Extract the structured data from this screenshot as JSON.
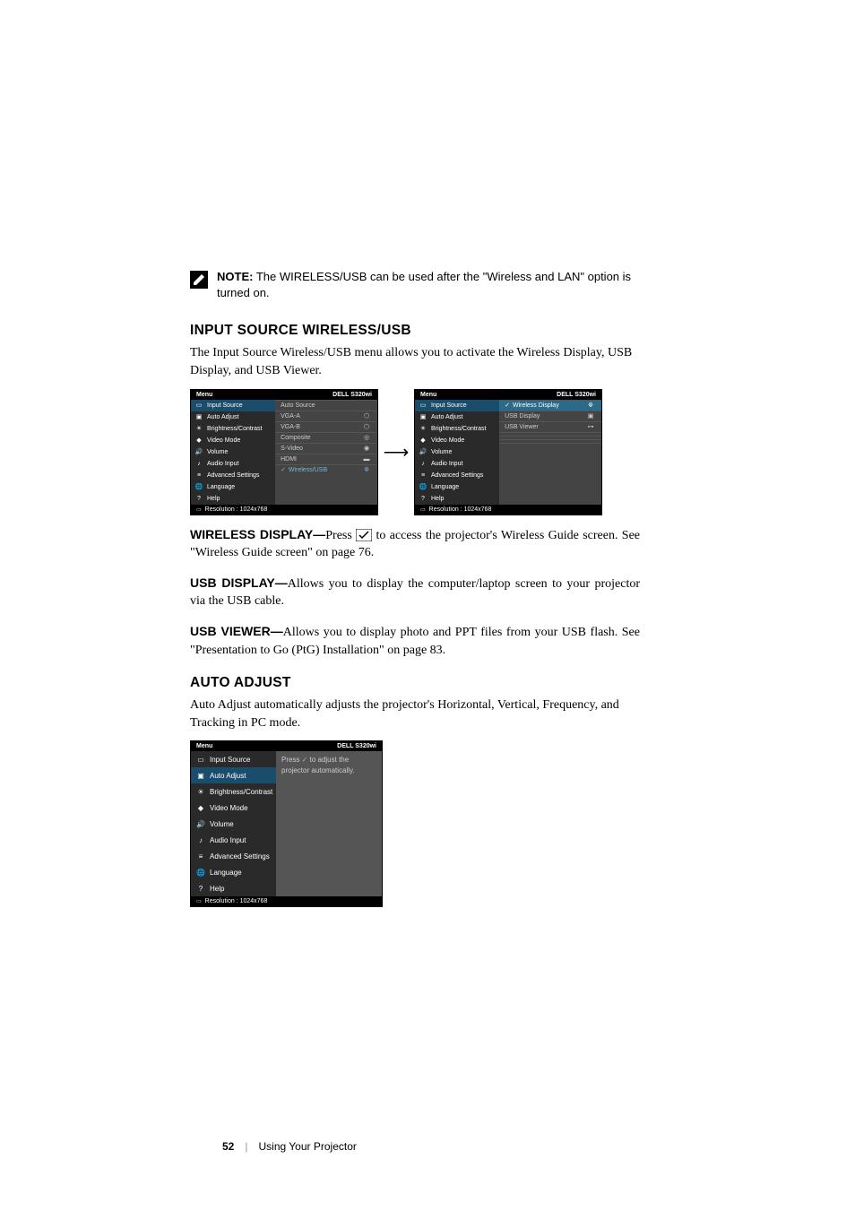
{
  "note": {
    "label": "NOTE:",
    "text": " The WIRELESS/USB can be used after the \"Wireless and LAN\" option is turned on."
  },
  "section1": {
    "heading": "INPUT SOURCE WIRELESS/USB",
    "intro": "The Input Source Wireless/USB menu allows you to activate the Wireless Display, USB Display, and USB Viewer."
  },
  "menu_left": {
    "title": "Menu",
    "model": "DELL S320wi",
    "items": [
      "Input Source",
      "Auto Adjust",
      "Brightness/Contrast",
      "Video Mode",
      "Volume",
      "Audio Input",
      "Advanced Settings",
      "Language",
      "Help"
    ],
    "options": [
      "Auto Source",
      "VGA-A",
      "VGA-B",
      "Composite",
      "S-Video",
      "HDMI",
      "Wireless/USB"
    ],
    "footer": "Resolution : 1024x768"
  },
  "menu_right": {
    "title": "Menu",
    "model": "DELL S320wi",
    "items": [
      "Input Source",
      "Auto Adjust",
      "Brightness/Contrast",
      "Video Mode",
      "Volume",
      "Audio Input",
      "Advanced Settings",
      "Language",
      "Help"
    ],
    "options": [
      "Wireless Display",
      "USB Display",
      "USB Viewer"
    ],
    "footer": "Resolution : 1024x768"
  },
  "defs": {
    "wireless": {
      "label": "WIRELESS DISPLAY—",
      "text1": "Press ",
      "text2": " to access the projector's Wireless Guide screen. See \"Wireless Guide screen\" on page 76."
    },
    "usb_display": {
      "label": "USB DISPLAY—",
      "text": "Allows you to display the computer/laptop screen to your projector via the USB cable."
    },
    "usb_viewer": {
      "label": "USB VIEWER—",
      "text": "Allows you to display photo and PPT files from your USB flash. See \"Presentation to Go (PtG) Installation\" on page 83."
    }
  },
  "section2": {
    "heading": "AUTO ADJUST",
    "intro": "Auto Adjust automatically adjusts the projector's Horizontal, Vertical, Frequency, and Tracking in PC mode."
  },
  "menu_auto": {
    "title": "Menu",
    "model": "DELL S320wi",
    "items": [
      "Input Source",
      "Auto Adjust",
      "Brightness/Contrast",
      "Video Mode",
      "Volume",
      "Audio Input",
      "Advanced Settings",
      "Language",
      "Help"
    ],
    "instruction1": "Press ",
    "instruction2": " to adjust the projector automatically.",
    "footer": "Resolution : 1024x768"
  },
  "footer": {
    "page": "52",
    "section": "Using Your Projector"
  }
}
